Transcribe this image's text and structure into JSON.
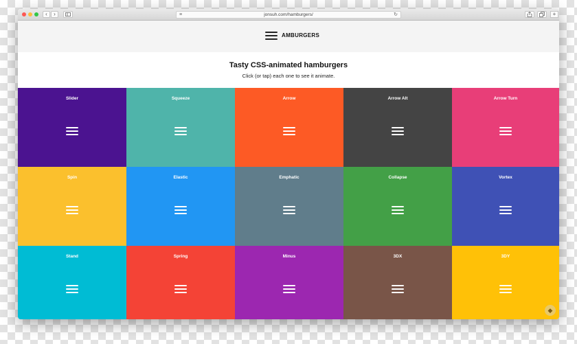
{
  "browser": {
    "url": "jonsuh.com/hamburgers/",
    "back_label": "‹",
    "forward_label": "›"
  },
  "header": {
    "brand": "AMBURGERS"
  },
  "intro": {
    "title": "Tasty CSS-animated hamburgers",
    "subtitle": "Click (or tap) each one to see it animate."
  },
  "tiles": [
    {
      "label": "Slider",
      "color": "#4b1390"
    },
    {
      "label": "Squeeze",
      "color": "#4fb4aa"
    },
    {
      "label": "Arrow",
      "color": "#fd5a25"
    },
    {
      "label": "Arrow Alt",
      "color": "#444444"
    },
    {
      "label": "Arrow Turn",
      "color": "#e83e78"
    },
    {
      "label": "Spin",
      "color": "#fbc02d"
    },
    {
      "label": "Elastic",
      "color": "#2196f3"
    },
    {
      "label": "Emphatic",
      "color": "#607d8b"
    },
    {
      "label": "Collapse",
      "color": "#43a047"
    },
    {
      "label": "Vortex",
      "color": "#3f51b5"
    },
    {
      "label": "Stand",
      "color": "#00bcd4"
    },
    {
      "label": "Spring",
      "color": "#f44336"
    },
    {
      "label": "Minus",
      "color": "#9c27b0"
    },
    {
      "label": "3DX",
      "color": "#795548"
    },
    {
      "label": "3DY",
      "color": "#ffc107"
    }
  ]
}
